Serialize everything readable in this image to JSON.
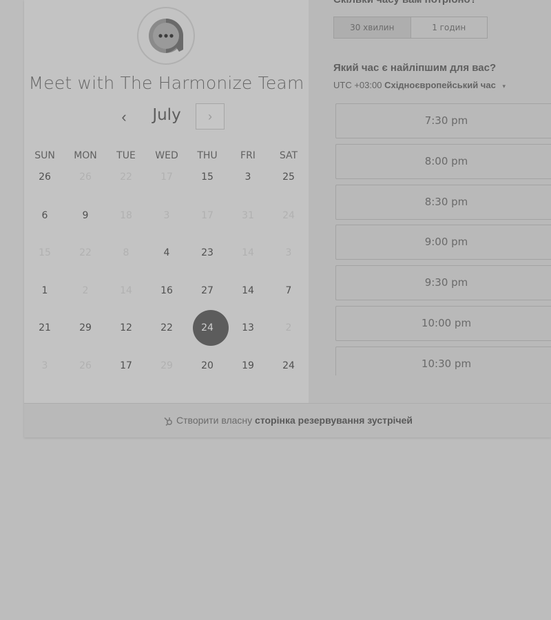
{
  "header": {
    "title": "Meet with The Harmonize Team",
    "logo_icon": "chat-bubble-icon"
  },
  "calendar": {
    "month": "July",
    "prev_icon": "‹",
    "next_icon": "›",
    "weekdays": [
      "SUN",
      "MON",
      "TUE",
      "WED",
      "THU",
      "FRI",
      "SAT"
    ],
    "weeks": [
      [
        "26",
        "26",
        "22",
        "17",
        "15",
        "3",
        "25"
      ],
      [
        "6",
        "9",
        "18",
        "3",
        "17",
        "31",
        "24"
      ],
      [
        "15",
        "22",
        "8",
        "4",
        "23",
        "14",
        "3"
      ],
      [
        "1",
        "2",
        "14",
        "16",
        "27",
        "14",
        "7"
      ],
      [
        "21",
        "29",
        "12",
        "22",
        "24",
        "13",
        "2"
      ],
      [
        "3",
        "26",
        "17",
        "29",
        "20",
        "19",
        "24"
      ]
    ],
    "selected_day": "24"
  },
  "duration": {
    "question": "Скільки часу вам потрібно?",
    "options": [
      "30 хвилин",
      "1 годин"
    ],
    "selected": "30 хвилин"
  },
  "time": {
    "question": "Який час є найліпшим для вас?",
    "timezone_offset": "UTC +03:00",
    "timezone_name": "Східноєвропейський час",
    "caret_icon": "▾",
    "slots": [
      "7:30 pm",
      "8:00 pm",
      "8:30 pm",
      "9:00 pm",
      "9:30 pm",
      "10:00 pm",
      "10:30 pm"
    ]
  },
  "footer": {
    "prefix": "Створити власну",
    "link": "сторінка резервування зустрічей",
    "icon": "hubspot-sprocket-icon"
  }
}
